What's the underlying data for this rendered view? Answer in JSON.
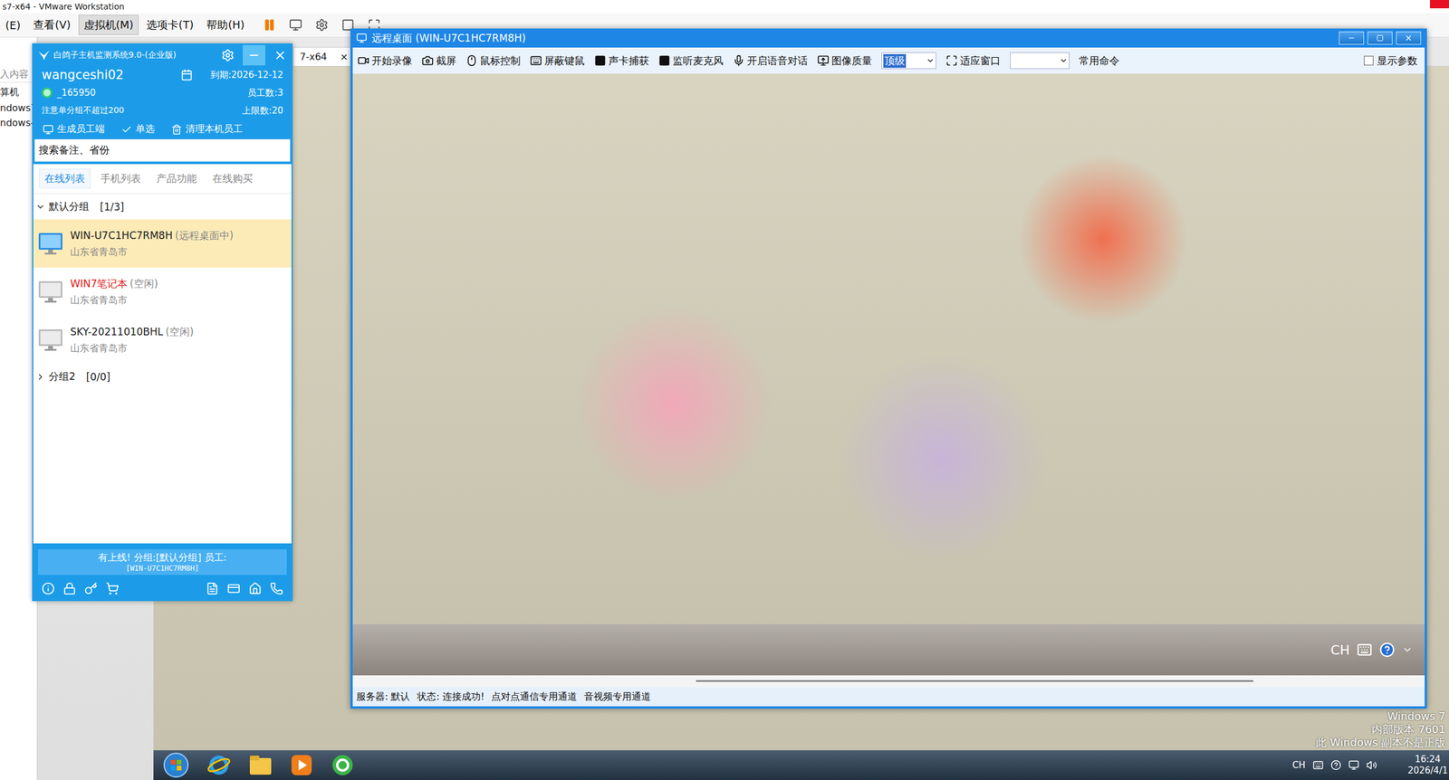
{
  "vmware": {
    "title": "s7-x64 - VMware Workstation",
    "menu": [
      {
        "label": "(E)",
        "selected": false
      },
      {
        "label": "查看(V)",
        "selected": false
      },
      {
        "label": "虚拟机(M)",
        "selected": true
      },
      {
        "label": "选项卡(T)",
        "selected": false
      },
      {
        "label": "帮助(H)",
        "selected": false
      }
    ],
    "library": {
      "search": "入内容",
      "items": [
        "算机",
        "ndows7",
        "ndows-"
      ]
    },
    "tab": {
      "label": "7-x64",
      "close": "×"
    }
  },
  "monitor_app": {
    "title": "白鸽子主机监测系统9.0-(企业版)",
    "user": {
      "name": "wangceshi02",
      "id": "_165950",
      "online": true,
      "expire": "到期:2026-12-12",
      "staff": "员工数:3",
      "note": "注意单分组不超过200",
      "limit": "上限数:20"
    },
    "actions": [
      "生成员工端",
      "单选",
      "清理本机员工"
    ],
    "search": {
      "placeholder": "搜索备注、省份"
    },
    "tabs": [
      {
        "label": "在线列表",
        "selected": true
      },
      {
        "label": "手机列表",
        "selected": false
      },
      {
        "label": "产品功能",
        "selected": false
      },
      {
        "label": "在线购买",
        "selected": false
      }
    ],
    "groups": [
      {
        "name": "默认分组",
        "count": "[1/3]",
        "expanded": true,
        "hosts": [
          {
            "name": "WIN-U7C1HC7RM8H",
            "status": "(远程桌面中)",
            "location": "山东省青岛市",
            "selected": true,
            "color": "#222222"
          },
          {
            "name": "WIN7笔记本",
            "status": "(空闲)",
            "location": "山东省青岛市",
            "selected": false,
            "color": "#e02020"
          },
          {
            "name": "SKY-20211010BHL",
            "status": "(空闲)",
            "location": "山东省青岛市",
            "selected": false,
            "color": "#222222"
          }
        ]
      },
      {
        "name": "分组2",
        "count": "[0/0]",
        "expanded": false,
        "hosts": []
      }
    ],
    "notice": {
      "line1": "有上线! 分组:[默认分组] 员工:",
      "line2": "[WIN-U7C1HC7RM8H]"
    }
  },
  "remote_window": {
    "title": "远程桌面 (WIN-U7C1HC7RM8H)",
    "toolbar": [
      {
        "label": "开始录像",
        "kind": "button"
      },
      {
        "label": "截屏",
        "kind": "button"
      },
      {
        "label": "鼠标控制",
        "kind": "button"
      },
      {
        "label": "屏蔽键鼠",
        "kind": "button"
      },
      {
        "label": "声卡捕获",
        "kind": "button"
      },
      {
        "label": "监听麦克风",
        "kind": "button"
      },
      {
        "label": "开启语音对话",
        "kind": "button"
      },
      {
        "label": "图像质量",
        "kind": "button"
      },
      {
        "label": "顶级",
        "kind": "select"
      },
      {
        "label": "适应窗口",
        "kind": "button"
      },
      {
        "label": "",
        "kind": "select"
      },
      {
        "label": "常用命令",
        "kind": "button"
      }
    ],
    "show_params": {
      "label": "显示参数",
      "checked": false
    },
    "remote_screen": {
      "tray_lang": "CH",
      "h_scroll": {
        "start": 0.32,
        "level": 0.52
      }
    },
    "status": [
      "服务器: 默认",
      "状态: 连接成功!",
      "点对点通信专用通道",
      "音视频专用通道"
    ]
  },
  "guest_desktop": {
    "watermark": [
      "Windows 7",
      "内部版本 7601",
      "此 Windows 副本不是正版"
    ],
    "tray": {
      "lang": "CH",
      "time": "16:24",
      "date": "2026/4/1"
    }
  }
}
